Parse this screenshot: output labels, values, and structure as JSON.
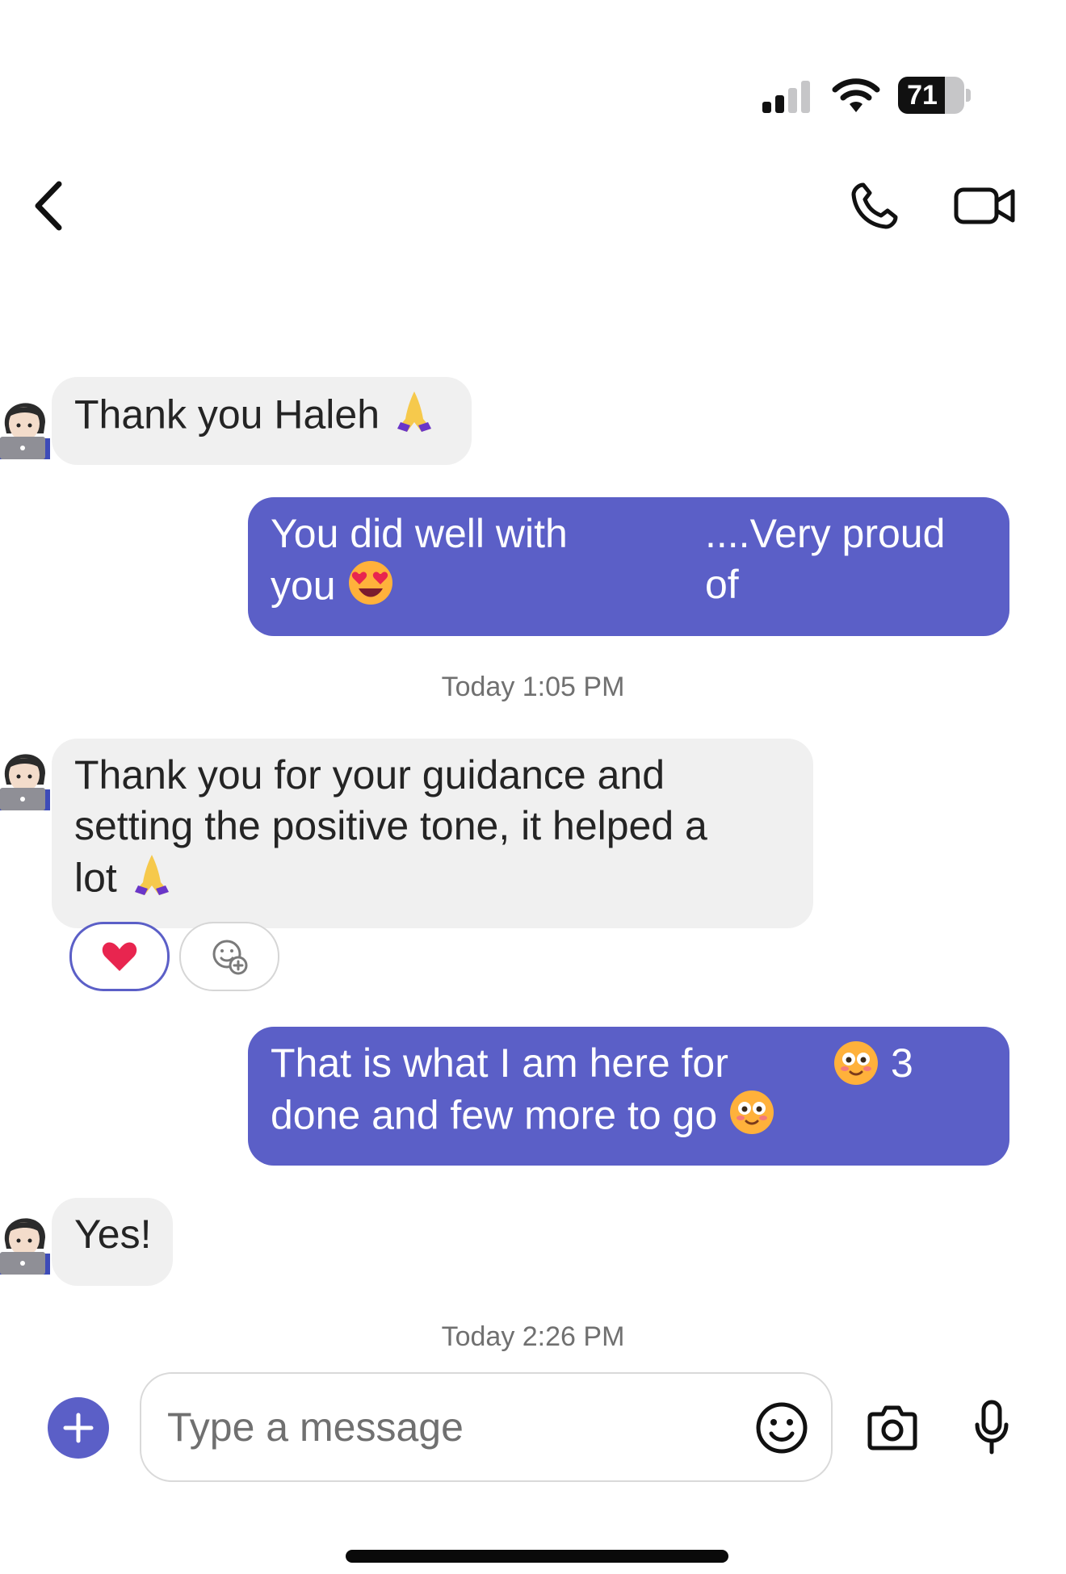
{
  "status_bar": {
    "battery": "71",
    "battery_level": 0.71,
    "colors": {
      "active_bar": "#111111",
      "inactive_bar": "#c6c6c8"
    }
  },
  "header": {
    "back_icon": "chevron-left-icon",
    "call_icon": "phone-icon",
    "video_icon": "video-camera-icon"
  },
  "messages": [
    {
      "direction": "incoming",
      "text": "Thank you Haleh",
      "emoji": "folded-hands"
    },
    {
      "direction": "outgoing",
      "line1": "You did well with",
      "line1_right": "....Very proud of",
      "line2": "you",
      "emoji": "heart-eyes"
    },
    {
      "direction": "timestamp",
      "text": "Today 1:05 PM"
    },
    {
      "direction": "incoming",
      "line1": "Thank you for your guidance and",
      "line2": "setting the positive tone, it helped a",
      "line3": "lot",
      "emoji": "folded-hands",
      "reaction": "heart"
    },
    {
      "direction": "outgoing",
      "line1": "That is what I am here for",
      "line1_right": "3",
      "line2": "done and few more to go",
      "emoji": "smiling-blush"
    },
    {
      "direction": "incoming",
      "text": "Yes!"
    },
    {
      "direction": "timestamp",
      "text": "Today 2:26 PM"
    }
  ],
  "composer": {
    "placeholder": "Type a message",
    "plus_icon": "plus-icon",
    "emoji_icon": "smiley-icon",
    "camera_icon": "camera-icon",
    "mic_icon": "microphone-icon"
  },
  "colors": {
    "accent": "#5b5fc7",
    "incoming_bubble": "#f0f0f0",
    "timestamp_text": "#707070",
    "reaction_heart": "#e8254f"
  }
}
